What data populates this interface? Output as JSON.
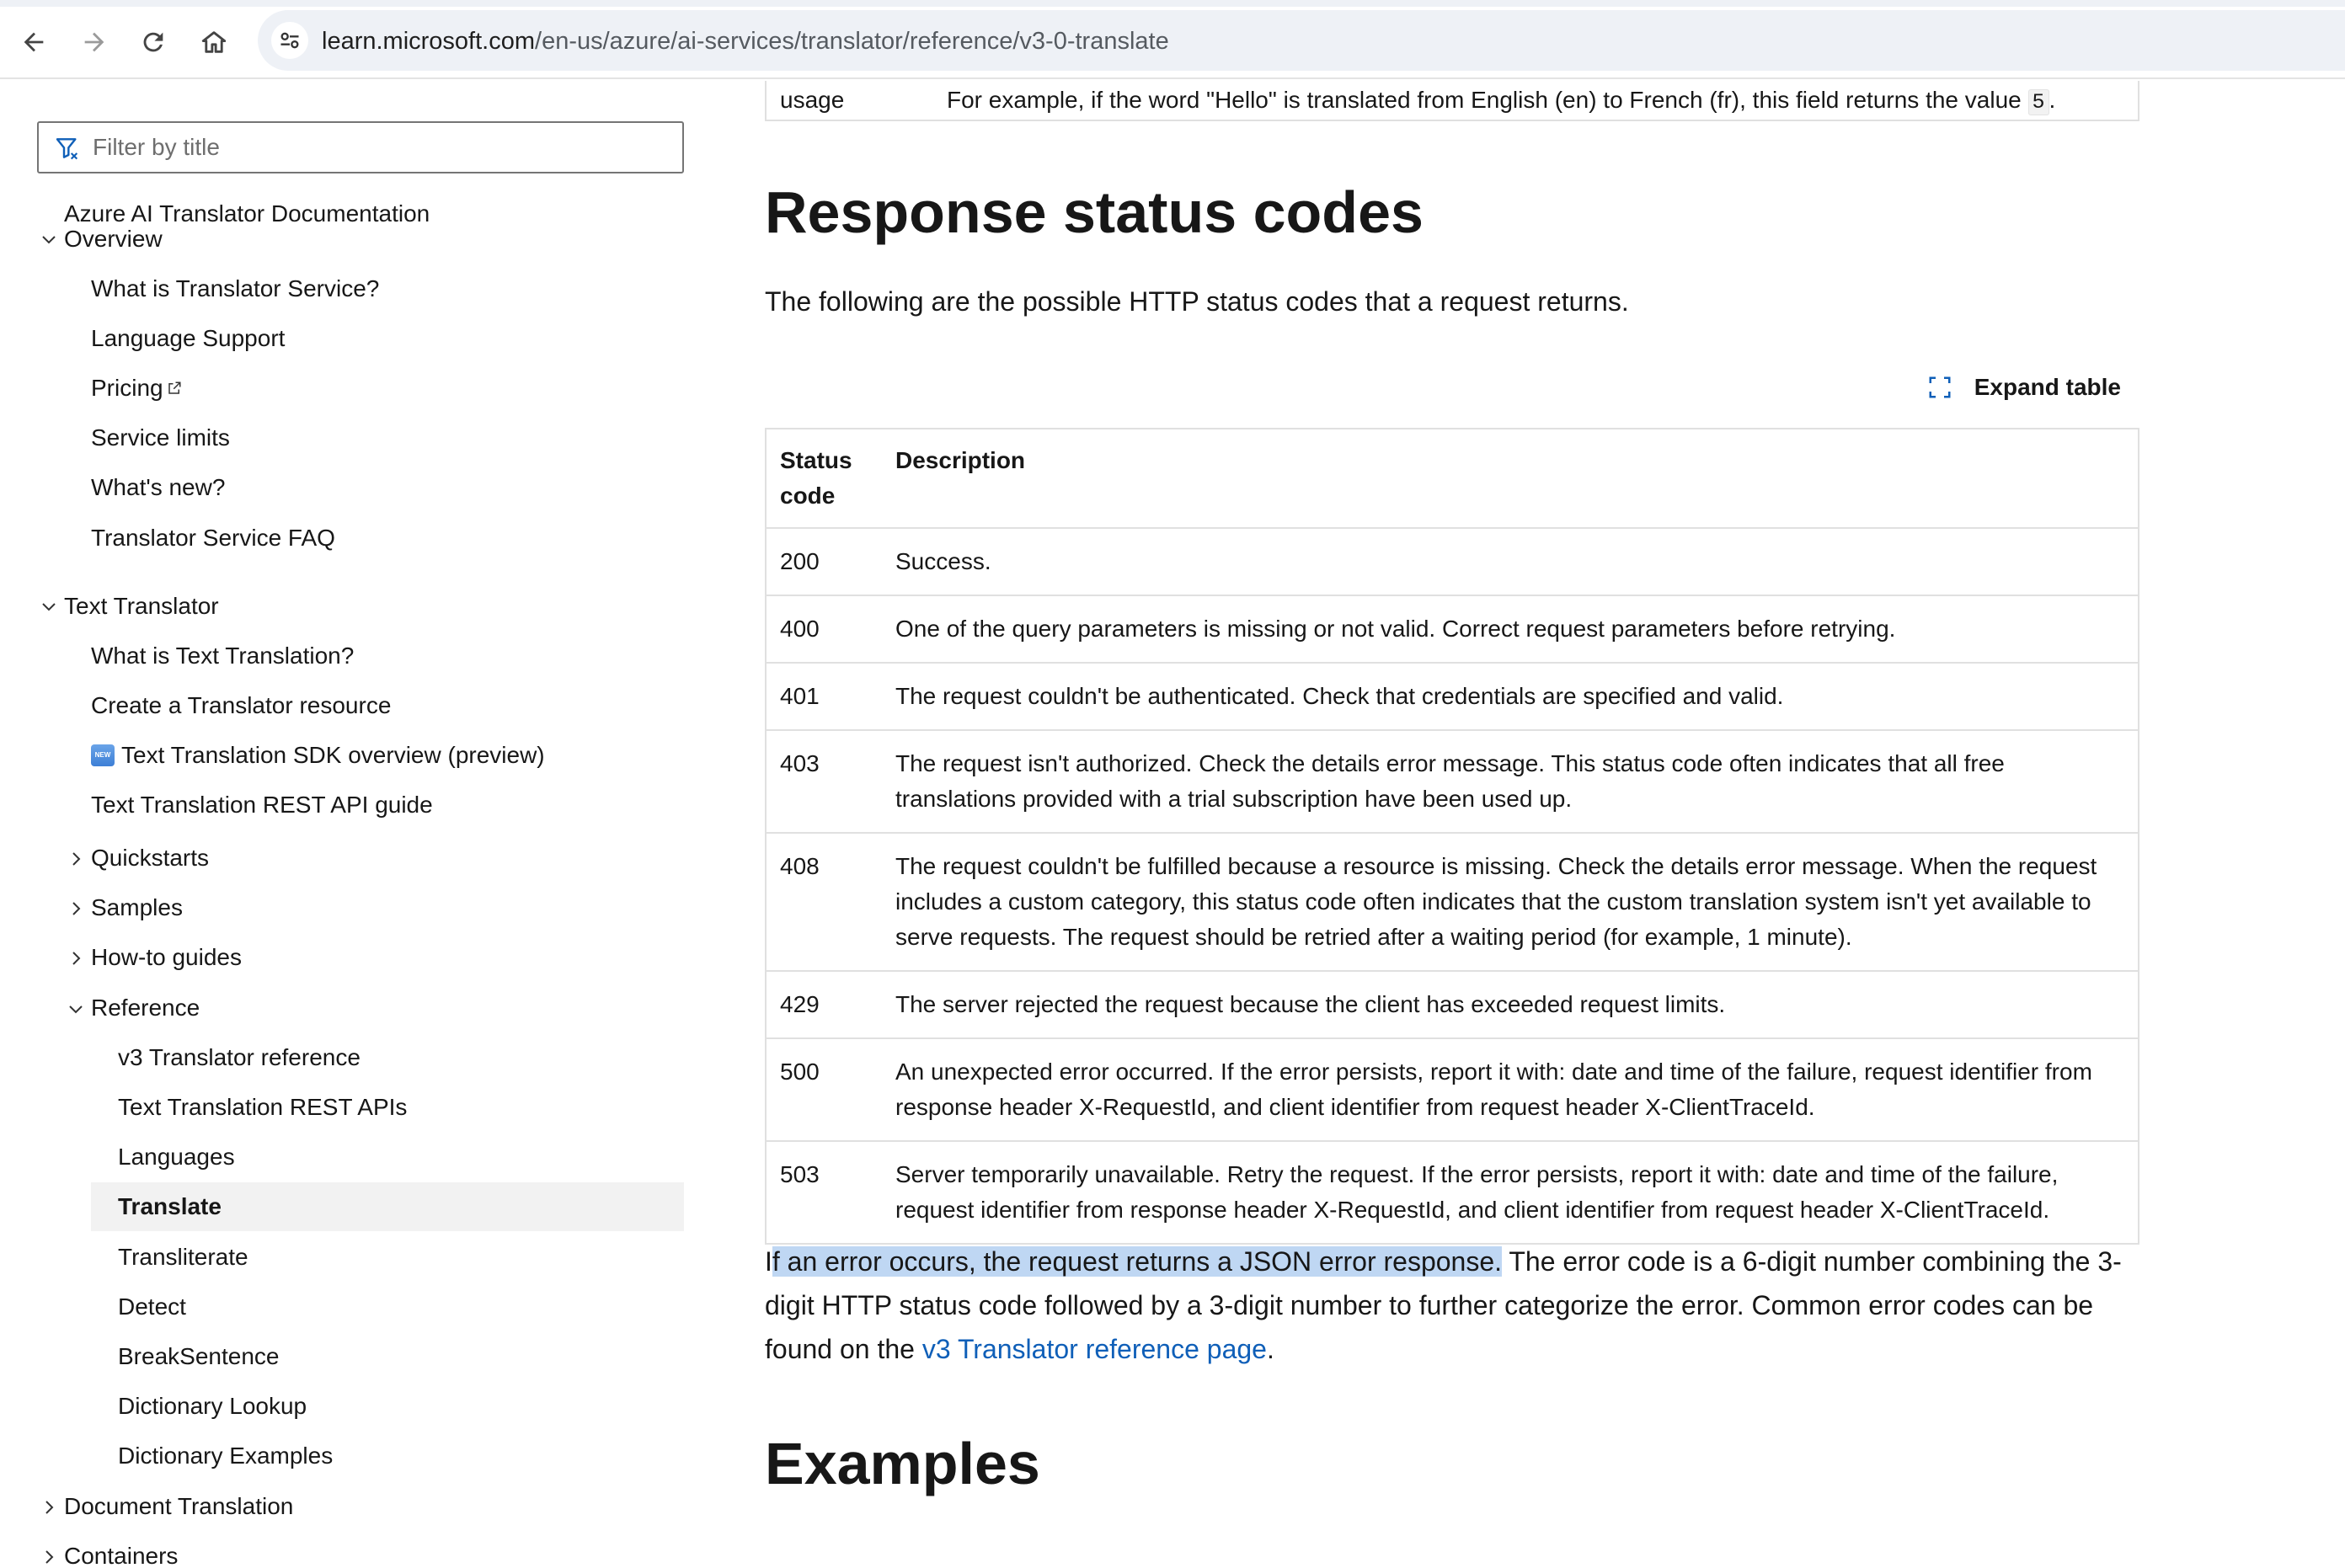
{
  "browser": {
    "url_host": "learn.microsoft.com",
    "url_path": "/en-us/azure/ai-services/translator/reference/v3-0-translate"
  },
  "sidebar": {
    "filter_placeholder": "Filter by title",
    "items": [
      {
        "label": "Azure AI Translator Documentation"
      },
      {
        "label": "Overview"
      },
      {
        "label": "What is Translator Service?"
      },
      {
        "label": "Language Support"
      },
      {
        "label": "Pricing"
      },
      {
        "label": "Service limits"
      },
      {
        "label": "What's new?"
      },
      {
        "label": "Translator Service FAQ"
      },
      {
        "label": "Text Translator"
      },
      {
        "label": "What is Text Translation?"
      },
      {
        "label": "Create a Translator resource"
      },
      {
        "label": "Text Translation SDK overview (preview)"
      },
      {
        "label": "Text Translation REST API guide"
      },
      {
        "label": "Quickstarts"
      },
      {
        "label": "Samples"
      },
      {
        "label": "How-to guides"
      },
      {
        "label": "Reference"
      },
      {
        "label": "v3 Translator reference"
      },
      {
        "label": "Text Translation REST APIs"
      },
      {
        "label": "Languages"
      },
      {
        "label": "Translate"
      },
      {
        "label": "Transliterate"
      },
      {
        "label": "Detect"
      },
      {
        "label": "BreakSentence"
      },
      {
        "label": "Dictionary Lookup"
      },
      {
        "label": "Dictionary Examples"
      },
      {
        "label": "Document Translation"
      },
      {
        "label": "Containers"
      }
    ],
    "new_badge": "NEW"
  },
  "main": {
    "prev_row": {
      "name": "usage",
      "desc_before": "For example, if the word \"Hello\" is translated from English (en) to French (fr), this field returns the value ",
      "desc_code": "5",
      "desc_after": "."
    },
    "heading": "Response status codes",
    "intro": "The following are the possible HTTP status codes that a request returns.",
    "expand_label": "Expand table",
    "table": {
      "header_code_1": "Status",
      "header_code_2": "code",
      "header_desc": "Description",
      "rows": [
        {
          "code": "200",
          "desc": "Success."
        },
        {
          "code": "400",
          "desc": "One of the query parameters is missing or not valid. Correct request parameters before retrying."
        },
        {
          "code": "401",
          "desc": "The request couldn't be authenticated. Check that credentials are specified and valid."
        },
        {
          "code": "403",
          "desc": "The request isn't authorized. Check the details error message. This status code often indicates that all free translations provided with a trial subscription have been used up."
        },
        {
          "code": "408",
          "desc": "The request couldn't be fulfilled because a resource is missing. Check the details error message. When the request includes a custom category, this status code often indicates that the custom translation system isn't yet available to serve requests. The request should be retried after a waiting period (for example, 1 minute)."
        },
        {
          "code": "429",
          "desc": "The server rejected the request because the client has exceeded request limits."
        },
        {
          "code": "500",
          "desc": "An unexpected error occurred. If the error persists, report it with: date and time of the failure, request identifier from response header X-RequestId, and client identifier from request header X-ClientTraceId."
        },
        {
          "code": "503",
          "desc": "Server temporarily unavailable. Retry the request. If the error persists, report it with: date and time of the failure, request identifier from response header X-RequestId, and client identifier from request header X-ClientTraceId."
        }
      ]
    },
    "error_para": {
      "lead_char": "I",
      "highlighted": "f an error occurs, the request returns a JSON error response.",
      "rest": " The error code is a 6-digit number combining the 3-digit HTTP status code followed by a 3-digit number to further categorize the error. Common error codes can be found on the ",
      "link": "v3 Translator reference page",
      "end": "."
    },
    "examples_heading": "Examples"
  },
  "colors": {
    "link": "#0f5fb8",
    "selection": "#bfd7f3",
    "active_bg": "#f2f2f2"
  }
}
